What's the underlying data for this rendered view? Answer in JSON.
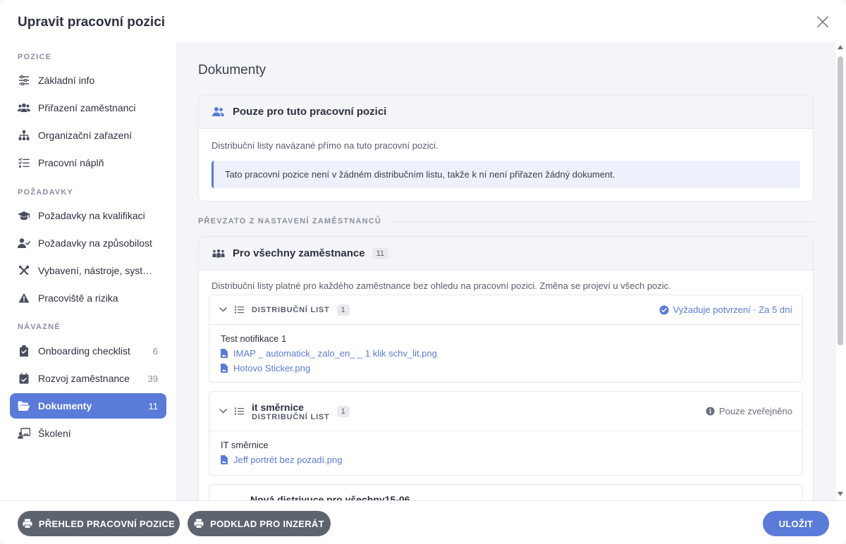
{
  "modal": {
    "title": "Upravit pracovní pozici"
  },
  "sidebar": {
    "sections": [
      {
        "label": "POZICE"
      },
      {
        "label": "POŽADAVKY"
      },
      {
        "label": "NÁVAZNÉ"
      }
    ],
    "items": [
      {
        "label": "Základní info",
        "icon": "sliders-icon"
      },
      {
        "label": "Přiřazení zaměstnanci",
        "icon": "users-icon"
      },
      {
        "label": "Organizační zařazení",
        "icon": "sitemap-icon"
      },
      {
        "label": "Pracovní náplň",
        "icon": "checklist-icon"
      },
      {
        "label": "Požadavky na kvalifikaci",
        "icon": "graduation-cap-icon"
      },
      {
        "label": "Požadavky na způsobilost",
        "icon": "user-check-icon"
      },
      {
        "label": "Vybavení, nástroje, systé…",
        "icon": "tools-icon"
      },
      {
        "label": "Pracoviště a rizika",
        "icon": "warning-icon"
      },
      {
        "label": "Onboarding checklist",
        "icon": "clipboard-icon",
        "count": "6"
      },
      {
        "label": "Rozvoj zaměstnance",
        "icon": "calendar-check-icon",
        "count": "39"
      },
      {
        "label": "Dokumenty",
        "icon": "folder-open-icon",
        "count": "11",
        "active": true
      },
      {
        "label": "Školení",
        "icon": "chalkboard-teacher-icon"
      }
    ]
  },
  "main": {
    "title": "Dokumenty",
    "position_card": {
      "title": "Pouze pro tuto pracovní pozici",
      "description": "Distribuční listy navázané přímo na tuto pracovní pozici.",
      "alert": "Tato pracovní pozice není v žádném distribučním listu, takže k ní není přiřazen žádný dokument."
    },
    "divider": "PŘEVZATO Z NASTAVENÍ ZAMĚSTNANCŮ",
    "all_card": {
      "title": "Pro všechny zaměstnance",
      "badge": "11",
      "description": "Distribuční listy platné pro každého zaměstnance bez ohledu na pracovní pozici. Změna se projeví u všech pozic."
    },
    "lists": [
      {
        "kind": "DISTRIBUČNÍ LIST",
        "badge": "1",
        "status": "Vyžaduje potvrzení · Za 5 dní",
        "document": "Test notifikace 1",
        "files": [
          "IMAP _ automatick_ zalo_en_ _ 1 klik schv_lit.png",
          "Hotovo Sticker.png"
        ]
      },
      {
        "name": "it směrnice",
        "kind": "DISTRIBUČNÍ LIST",
        "badge": "1",
        "status": "Pouze zveřejněno",
        "document": "IT směrnice",
        "files": [
          "Jeff portrét bez pozadí.png"
        ]
      },
      {
        "name": "Nová distrivuce pro všechny15-06"
      }
    ]
  },
  "footer": {
    "overview_button": "PŘEHLED PRACOVNÍ POZICE",
    "ad_button": "PODKLAD PRO INZERÁT",
    "save_button": "ULOŽIT"
  },
  "colors": {
    "accent": "#5b7bd9",
    "dark_button": "#5d6470",
    "background": "#f4f5f8"
  }
}
